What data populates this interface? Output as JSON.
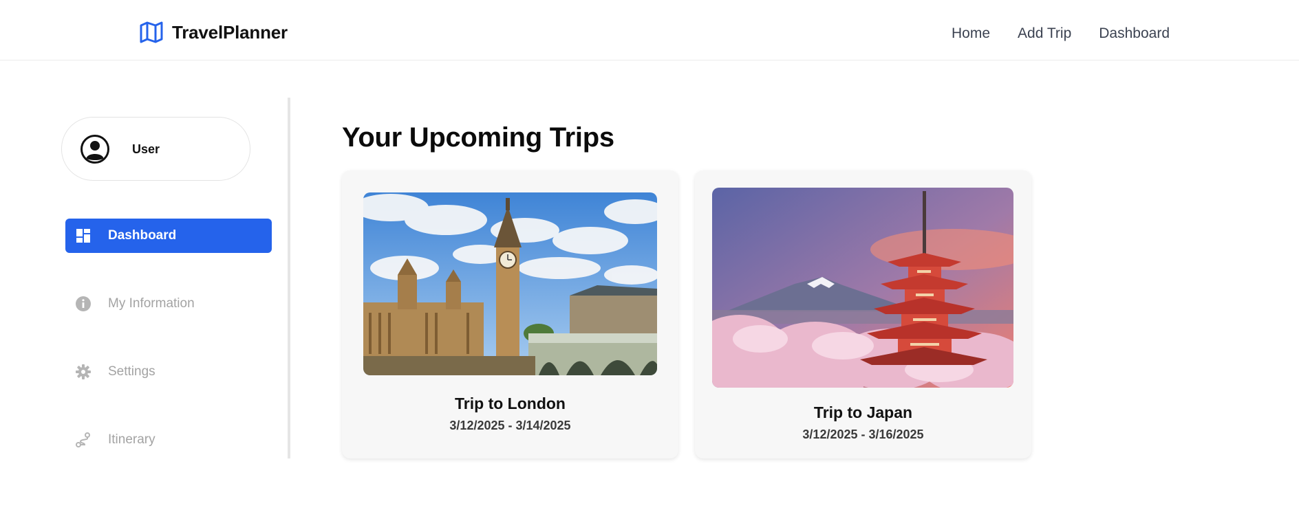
{
  "app": {
    "brand_name": "TravelPlanner",
    "brand_icon": "map-icon",
    "accent_color": "#2563eb"
  },
  "nav": {
    "items": [
      {
        "label": "Home"
      },
      {
        "label": "Add Trip"
      },
      {
        "label": "Dashboard"
      }
    ]
  },
  "sidebar": {
    "user": {
      "name": "User",
      "avatar_icon": "user-circle-icon"
    },
    "items": [
      {
        "label": "Dashboard",
        "icon": "dashboard-icon",
        "active": true
      },
      {
        "label": "My Information",
        "icon": "info-icon",
        "active": false
      },
      {
        "label": "Settings",
        "icon": "gear-icon",
        "active": false
      },
      {
        "label": "Itinerary",
        "icon": "route-icon",
        "active": false
      }
    ]
  },
  "main": {
    "title": "Your Upcoming Trips",
    "trips": [
      {
        "title": "Trip to London",
        "dates": "3/12/2025 - 3/14/2025",
        "image": "london-photo"
      },
      {
        "title": "Trip to Japan",
        "dates": "3/12/2025 - 3/16/2025",
        "image": "japan-photo"
      }
    ]
  }
}
